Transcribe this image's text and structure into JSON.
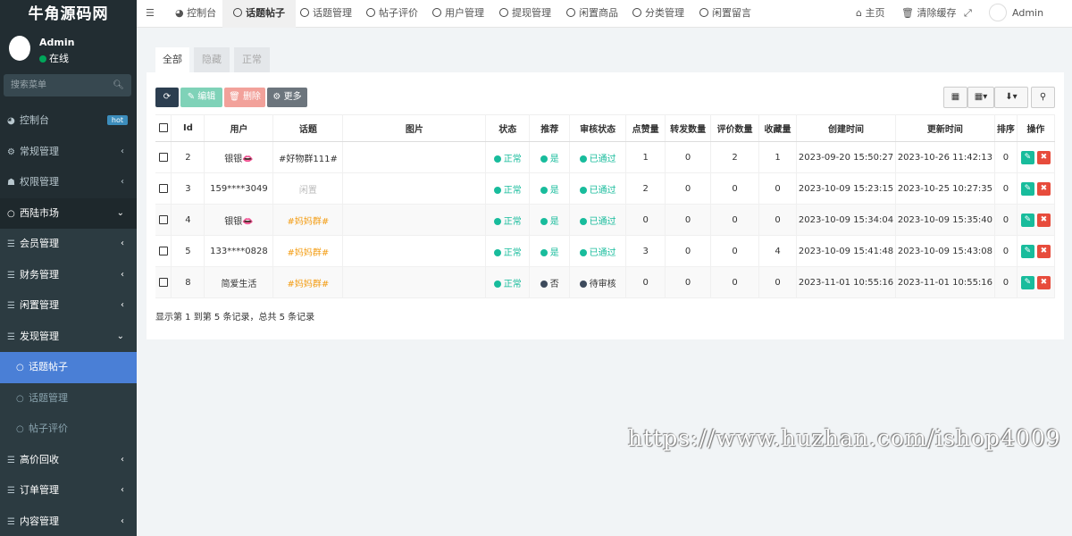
{
  "app": {
    "logo": "牛角源码网"
  },
  "user": {
    "name": "Admin",
    "status": "在线"
  },
  "sidebar": {
    "search_placeholder": "搜索菜单",
    "items": [
      {
        "label": "控制台",
        "badge": "hot"
      },
      {
        "label": "常规管理"
      },
      {
        "label": "权限管理"
      },
      {
        "label": "西陆市场"
      },
      {
        "label": "会员管理"
      },
      {
        "label": "财务管理"
      },
      {
        "label": "闲置管理"
      },
      {
        "label": "发现管理"
      },
      {
        "label": "话题帖子"
      },
      {
        "label": "话题管理"
      },
      {
        "label": "帖子评价"
      },
      {
        "label": "高价回收"
      },
      {
        "label": "订单管理"
      },
      {
        "label": "内容管理"
      }
    ]
  },
  "topnav": {
    "tabs": [
      "控制台",
      "话题帖子",
      "话题管理",
      "帖子评价",
      "用户管理",
      "提现管理",
      "闲置商品",
      "分类管理",
      "闲置留言"
    ],
    "home": "主页",
    "clear_cache": "清除缓存",
    "admin": "Admin"
  },
  "panel": {
    "tabs": [
      "全部",
      "隐藏",
      "正常"
    ],
    "toolbar": {
      "edit": "编辑",
      "delete": "删除",
      "more": "更多"
    },
    "columns": [
      "Id",
      "用户",
      "话题",
      "图片",
      "状态",
      "推荐",
      "审核状态",
      "点赞量",
      "转发数量",
      "评价数量",
      "收藏量",
      "创建时间",
      "更新时间",
      "排序",
      "操作"
    ],
    "rows": [
      {
        "id": "2",
        "user": "银银👄",
        "topic": "#好物群111#",
        "status": "正常",
        "recommend": "是",
        "review": "已通过",
        "likes": "1",
        "shares": "0",
        "comments": "2",
        "favorites": "1",
        "created": "2023-09-20 15:50:27",
        "updated": "2023-10-26 11:42:13",
        "sort": "0"
      },
      {
        "id": "3",
        "user": "159****3049",
        "topic": "闲置",
        "status": "正常",
        "recommend": "是",
        "review": "已通过",
        "likes": "2",
        "shares": "0",
        "comments": "0",
        "favorites": "0",
        "created": "2023-10-09 15:23:15",
        "updated": "2023-10-25 10:27:35",
        "sort": "0"
      },
      {
        "id": "4",
        "user": "银银👄",
        "topic": "#妈妈群#",
        "status": "正常",
        "recommend": "是",
        "review": "已通过",
        "likes": "0",
        "shares": "0",
        "comments": "0",
        "favorites": "0",
        "created": "2023-10-09 15:34:04",
        "updated": "2023-10-09 15:35:40",
        "sort": "0"
      },
      {
        "id": "5",
        "user": "133****0828",
        "topic": "#妈妈群#",
        "status": "正常",
        "recommend": "是",
        "review": "已通过",
        "likes": "3",
        "shares": "0",
        "comments": "0",
        "favorites": "4",
        "created": "2023-10-09 15:41:48",
        "updated": "2023-10-09 15:43:08",
        "sort": "0"
      },
      {
        "id": "8",
        "user": "简爱生活",
        "topic": "#妈妈群#",
        "status": "正常",
        "recommend": "否",
        "review": "待审核",
        "likes": "0",
        "shares": "0",
        "comments": "0",
        "favorites": "0",
        "created": "2023-11-01 10:55:16",
        "updated": "2023-11-01 10:55:16",
        "sort": "0"
      }
    ],
    "summary": "显示第 1 到第 5 条记录，总共 5 条记录"
  },
  "watermark": "https://www.huzhan.com/ishop4009",
  "colors": {
    "sidebar_bg": "#222d32",
    "active_item": "#4a7fd6",
    "success": "#18bc9c",
    "danger": "#e74c3c",
    "warning": "#f39c12"
  }
}
